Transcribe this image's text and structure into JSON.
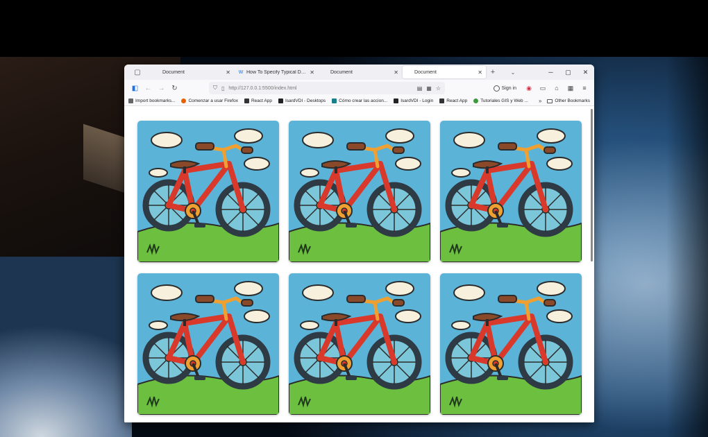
{
  "browser": {
    "tabs": [
      {
        "label": "Document",
        "active": false,
        "favicon": "page-icon"
      },
      {
        "label": "How To Specify Typical Device",
        "active": false,
        "favicon": "w-icon"
      },
      {
        "label": "Document",
        "active": false,
        "favicon": "page-icon"
      },
      {
        "label": "Document",
        "active": true,
        "favicon": "page-icon"
      }
    ],
    "url": "http://127.0.0.1:5500/index.html",
    "signin_label": "Sign in",
    "bookmarks": [
      {
        "label": "Import bookmarks...",
        "color": "#666666"
      },
      {
        "label": "Comenzar a usar Firefox",
        "color": "#e66000"
      },
      {
        "label": "React App",
        "color": "#333333"
      },
      {
        "label": "IsardVDI - Desktops",
        "color": "#222222"
      },
      {
        "label": "Cómo crear las accion...",
        "color": "#1a7f8c"
      },
      {
        "label": "IsardVDI - Login",
        "color": "#222222"
      },
      {
        "label": "React App",
        "color": "#333333"
      },
      {
        "label": "Tutoriales GIS y Web ...",
        "color": "#3c9a3c"
      }
    ],
    "other_bookmarks": "Other Bookmarks"
  },
  "gallery": {
    "image_subject": "bicycle-illustration",
    "items": [
      1,
      2,
      3,
      4,
      5,
      6
    ]
  },
  "colors": {
    "sky": "#5bb3d8",
    "grass": "#6cbf3f",
    "frame": "#d9392b",
    "tire": "#2e3a44",
    "accent": "#f0a030"
  }
}
